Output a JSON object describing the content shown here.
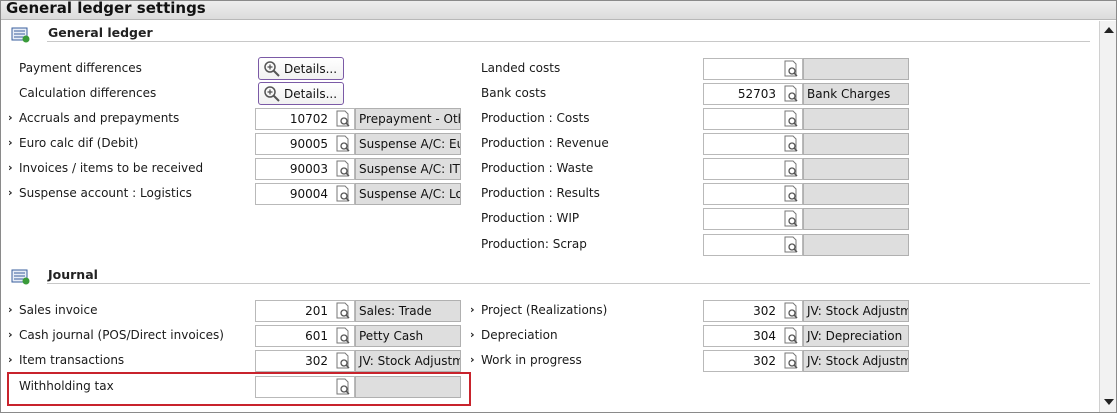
{
  "window": {
    "title": "General ledger settings"
  },
  "sections": {
    "general_ledger": {
      "label": "General ledger"
    },
    "journal": {
      "label": "Journal"
    }
  },
  "left_rows": [
    {
      "label": "Payment differences",
      "type": "button",
      "button_label": "Details..."
    },
    {
      "label": "Calculation differences",
      "type": "button",
      "button_label": "Details..."
    },
    {
      "label": "Accruals and prepayments",
      "type": "field",
      "code": "10702",
      "desc": "Prepayment - Othe"
    },
    {
      "label": "Euro calc dif (Debit)",
      "type": "field",
      "code": "90005",
      "desc": "Suspense A/C: Euro"
    },
    {
      "label": "Invoices / items to be received",
      "type": "field",
      "code": "90003",
      "desc": "Suspense A/C: ITR"
    },
    {
      "label": "Suspense account : Logistics",
      "type": "field",
      "code": "90004",
      "desc": "Suspense A/C: Logi"
    }
  ],
  "right_rows": [
    {
      "label": "Landed costs",
      "code": "",
      "desc": ""
    },
    {
      "label": "Bank costs",
      "code": "52703",
      "desc": "Bank Charges"
    },
    {
      "label": "Production : Costs",
      "code": "",
      "desc": ""
    },
    {
      "label": "Production : Revenue",
      "code": "",
      "desc": ""
    },
    {
      "label": "Production : Waste",
      "code": "",
      "desc": ""
    },
    {
      "label": "Production : Results",
      "code": "",
      "desc": ""
    },
    {
      "label": "Production : WIP",
      "code": "",
      "desc": ""
    },
    {
      "label": "Production: Scrap",
      "code": "",
      "desc": ""
    }
  ],
  "journal_left": [
    {
      "label": "Sales invoice",
      "code": "201",
      "desc": "Sales: Trade"
    },
    {
      "label": "Cash journal (POS/Direct invoices)",
      "code": "601",
      "desc": "Petty Cash"
    },
    {
      "label": "Item transactions",
      "code": "302",
      "desc": "JV: Stock Adjustme"
    },
    {
      "label": "Withholding tax",
      "code": "",
      "desc": ""
    }
  ],
  "journal_right": [
    {
      "label": "Project (Realizations)",
      "code": "302",
      "desc": "JV: Stock Adjustme"
    },
    {
      "label": "Depreciation",
      "code": "304",
      "desc": "JV: Depreciation"
    },
    {
      "label": "Work in progress",
      "code": "302",
      "desc": "JV: Stock Adjustme"
    }
  ],
  "colors": {
    "highlight": "#c8232c",
    "button_border": "#7b5aa6",
    "readonly_bg": "#dedede"
  },
  "icons": {
    "section": "ledger-book-icon",
    "lookup": "document-search-icon",
    "details": "zoom-in-icon",
    "expand": "chevron-right-icon"
  }
}
